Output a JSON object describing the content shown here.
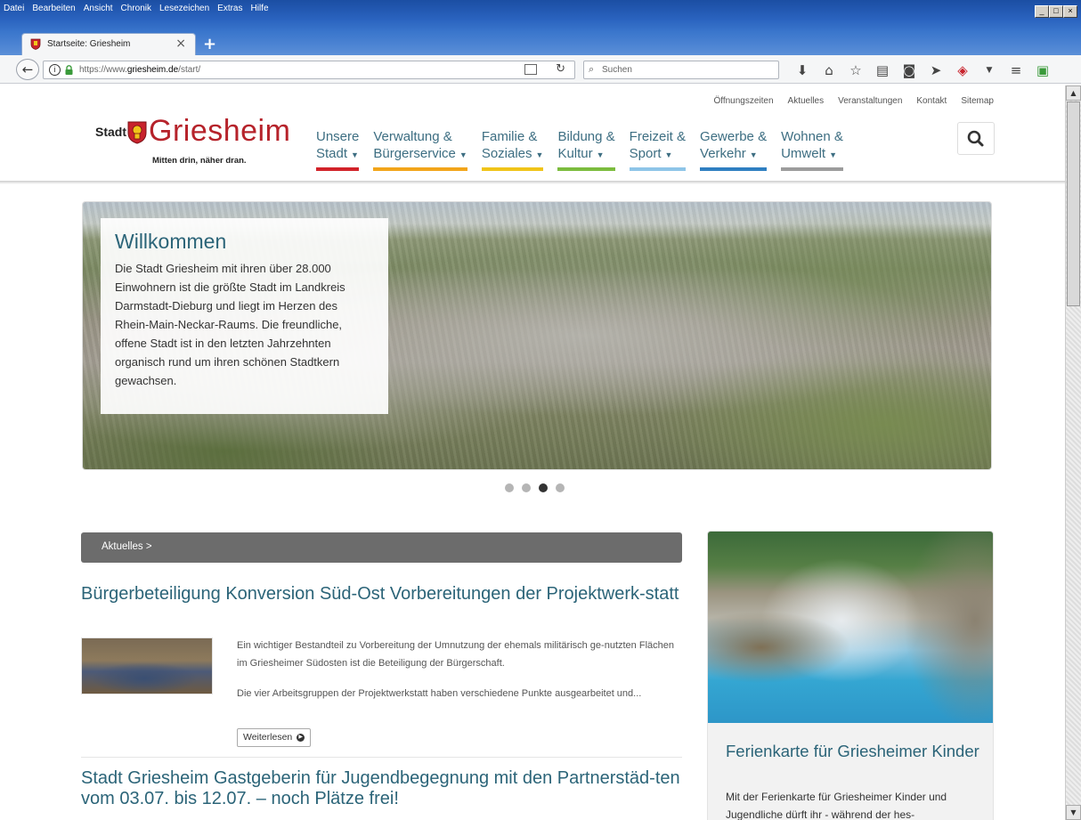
{
  "browser": {
    "menu": [
      {
        "label": "Datei"
      },
      {
        "label": "Bearbeiten"
      },
      {
        "label": "Ansicht"
      },
      {
        "label": "Chronik"
      },
      {
        "label": "Lesezeichen"
      },
      {
        "label": "Extras"
      },
      {
        "label": "Hilfe"
      }
    ],
    "tab_title": "Startseite: Griesheim",
    "tab_close": "×",
    "new_tab": "+",
    "url_prefix": "https://www.",
    "url_domain": "griesheim.de",
    "url_path": "/start/",
    "search_placeholder": "Suchen",
    "toolbar_icons": [
      "download-icon",
      "home-icon",
      "bookmark-star-icon",
      "library-icon",
      "pocket-icon",
      "send-icon",
      "extension-icon",
      "menu-icon"
    ]
  },
  "site": {
    "utility_links": [
      "Öffnungszeiten",
      "Aktuelles",
      "Veranstaltungen",
      "Kontakt",
      "Sitemap"
    ],
    "logo": {
      "prefix": "Stadt",
      "name": "Griesheim",
      "slogan": "Mitten drin, näher dran."
    },
    "nav": [
      {
        "line1": "Unsere",
        "line2": "Stadt",
        "color": "#d2232a"
      },
      {
        "line1": "Verwaltung &",
        "line2": "Bürgerservice",
        "color": "#f2a51a"
      },
      {
        "line1": "Familie &",
        "line2": "Soziales",
        "color": "#f0c419"
      },
      {
        "line1": "Bildung &",
        "line2": "Kultur",
        "color": "#7cbc3e"
      },
      {
        "line1": "Freizeit &",
        "line2": "Sport",
        "color": "#8ec5e8"
      },
      {
        "line1": "Gewerbe &",
        "line2": "Verkehr",
        "color": "#2f7fc1"
      },
      {
        "line1": "Wohnen &",
        "line2": "Umwelt",
        "color": "#9c9c9c"
      }
    ],
    "hero": {
      "title": "Willkommen",
      "text": "Die Stadt Griesheim mit ihren über 28.000 Einwohnern ist die größte Stadt im Landkreis Darmstadt-Dieburg und liegt im Herzen des Rhein-Main-Neckar-Raums. Die freundliche, offene Stadt ist in den letzten Jahrzehnten organisch rund um ihren schönen Stadtkern gewachsen.",
      "slide_count": 4,
      "active_slide": 3
    },
    "news": {
      "heading": "Aktuelles >",
      "articles": [
        {
          "title": "Bürgerbeteiligung Konversion Süd-Ost Vorbereitungen der Projektwerk-statt",
          "para1": "Ein wichtiger Bestandteil zu Vorbereitung der Umnutzung der ehemals militärisch ge-nutzten Flächen im Griesheimer Südosten ist die Beteiligung der Bürgerschaft.",
          "para2": "Die vier Arbeitsgruppen der Projektwerkstatt haben verschiedene Punkte ausgearbeitet und...",
          "more": "Weiterlesen"
        },
        {
          "title": "Stadt Griesheim Gastgeberin für Jugendbegegnung mit den Partnerstäd-ten vom 03.07. bis 12.07. – noch Plätze frei!"
        }
      ]
    },
    "feature": {
      "title": "Ferienkarte für Griesheimer Kinder",
      "text": "Mit der Ferienkarte für Griesheimer Kinder und Jugendliche dürft ihr - während der hes-"
    }
  }
}
